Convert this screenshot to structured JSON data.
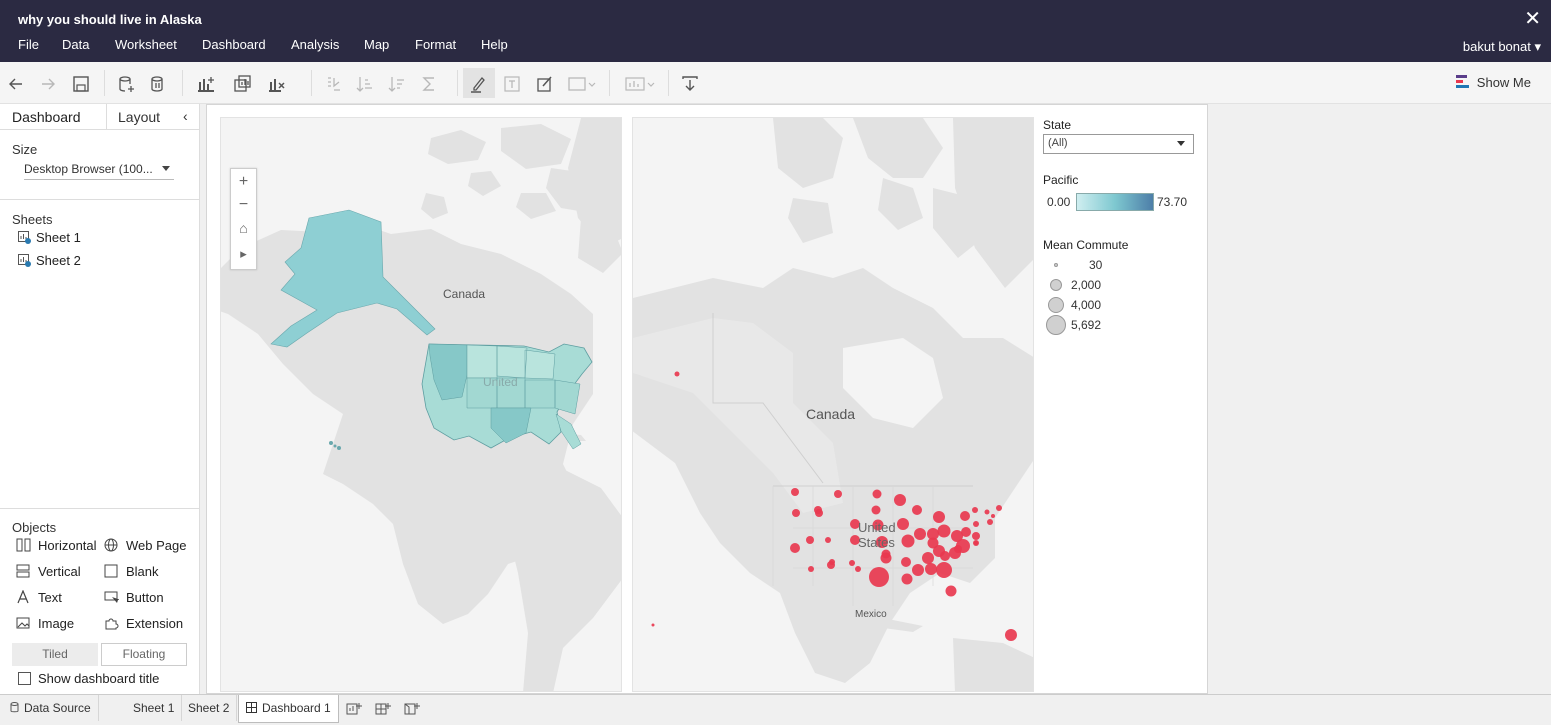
{
  "window": {
    "title": "why you should live in Alaska",
    "close_glyph": "✕"
  },
  "menu": {
    "items": [
      "File",
      "Data",
      "Worksheet",
      "Dashboard",
      "Analysis",
      "Map",
      "Format",
      "Help"
    ],
    "user": "bakut bonat ▾"
  },
  "toolbar": {
    "show_me_label": "Show Me"
  },
  "left_panel": {
    "tabs": [
      "Dashboard",
      "Layout"
    ],
    "collapse_glyph": "‹",
    "size_heading": "Size",
    "size_value": "Desktop Browser (100...",
    "sheets_heading": "Sheets",
    "sheets": [
      "Sheet 1",
      "Sheet 2"
    ],
    "objects_heading": "Objects",
    "objects": [
      "Horizontal",
      "Web Page",
      "Vertical",
      "Blank",
      "Text",
      "Button",
      "Image",
      "Extension"
    ],
    "tiled_label": "Tiled",
    "floating_label": "Floating",
    "show_title_label": "Show dashboard title"
  },
  "map1": {
    "canada_label": "Canada",
    "us_label": "United",
    "zoom": [
      "+",
      "−",
      "⌂",
      "▸"
    ],
    "fill_color": "#8ecfd3"
  },
  "map2": {
    "canada_label": "Canada",
    "us_label_1": "United",
    "us_label_2": "States",
    "mexico_label": "Mexico",
    "mark_color": "#e8384f"
  },
  "legend": {
    "state_title": "State",
    "state_value": "(All)",
    "pacific_title": "Pacific",
    "pacific_min": "0.00",
    "pacific_max": "73.70",
    "commute_title": "Mean Commute",
    "commute_sizes": [
      "30",
      "2,000",
      "4,000",
      "5,692"
    ]
  },
  "bottom_tabs": {
    "data_source": "Data Source",
    "sheets": [
      "Sheet 1",
      "Sheet 2"
    ],
    "dashboard": "Dashboard 1"
  }
}
